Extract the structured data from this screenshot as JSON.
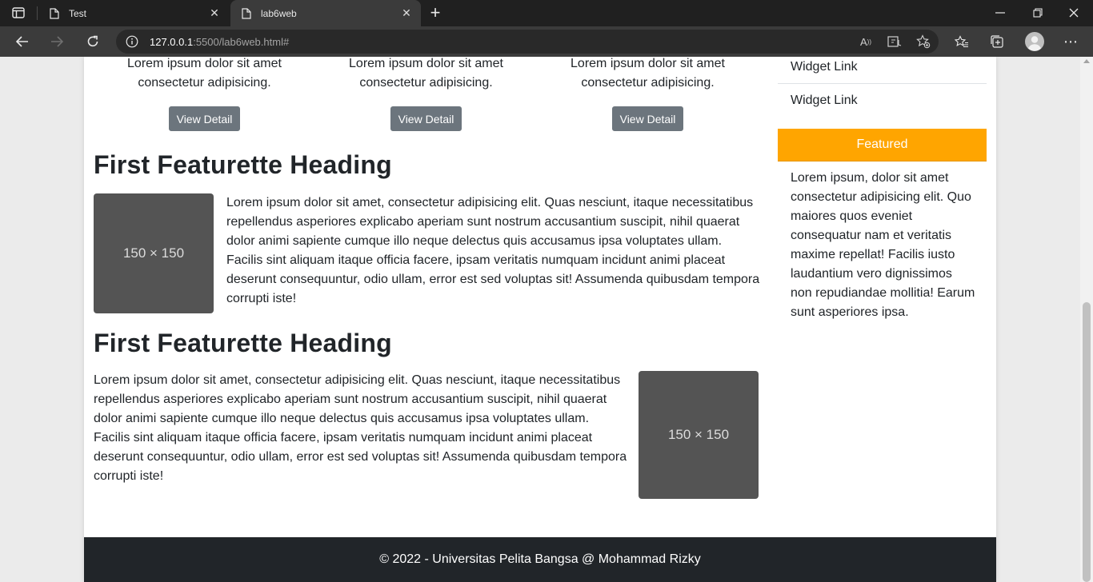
{
  "browser": {
    "tabs": [
      {
        "label": "Test",
        "active": false
      },
      {
        "label": "lab6web",
        "active": true
      }
    ],
    "new_tab_label": "+",
    "url_host": "127.0.0.1",
    "url_rest": ":5500/lab6web.html#",
    "colors": {
      "chrome_dark": "#202020",
      "chrome_mid": "#3b3b3b",
      "url_box": "#292929"
    }
  },
  "page": {
    "features": [
      {
        "text": "Lorem ipsum dolor sit amet consectetur adipisicing.",
        "button": "View Detail"
      },
      {
        "text": "Lorem ipsum dolor sit amet consectetur adipisicing.",
        "button": "View Detail"
      },
      {
        "text": "Lorem ipsum dolor sit amet consectetur adipisicing.",
        "button": "View Detail"
      }
    ],
    "featurettes": [
      {
        "heading": "First Featurette Heading",
        "image_label": "150 × 150",
        "text": "Lorem ipsum dolor sit amet, consectetur adipisicing elit. Quas nesciunt, itaque necessitatibus repellendus asperiores explicabo aperiam sunt nostrum accusantium suscipit, nihil quaerat dolor animi sapiente cumque illo neque delectus quis accusamus ipsa voluptates ullam. Facilis sint aliquam itaque officia facere, ipsam veritatis numquam incidunt animi placeat deserunt consequuntur, odio ullam, error est sed voluptas sit! Assumenda quibusdam tempora corrupti iste!"
      },
      {
        "heading": "First Featurette Heading",
        "image_label": "150 × 150",
        "text": "Lorem ipsum dolor sit amet, consectetur adipisicing elit. Quas nesciunt, itaque necessitatibus repellendus asperiores explicabo aperiam sunt nostrum accusantium suscipit, nihil quaerat dolor animi sapiente cumque illo neque delectus quis accusamus ipsa voluptates ullam. Facilis sint aliquam itaque officia facere, ipsam veritatis numquam incidunt animi placeat deserunt consequuntur, odio ullam, error est sed voluptas sit! Assumenda quibusdam tempora corrupti iste!"
      }
    ],
    "sidebar": {
      "widget_links": [
        "Widget Link",
        "Widget Link"
      ],
      "featured_title": "Featured",
      "featured_text": "Lorem ipsum, dolor sit amet consectetur adipisicing elit. Quo maiores quos eveniet consequatur nam et veritatis maxime repellat! Facilis iusto laudantium vero dignissimos non repudiandae mollitia! Earum sunt asperiores ipsa."
    },
    "footer": "© 2022 - Universitas Pelita Bangsa @ Mohammad Rizky",
    "colors": {
      "button": "#6c757d",
      "featured": "#ffa500",
      "placeholder": "#545454",
      "footer": "#212529"
    }
  }
}
